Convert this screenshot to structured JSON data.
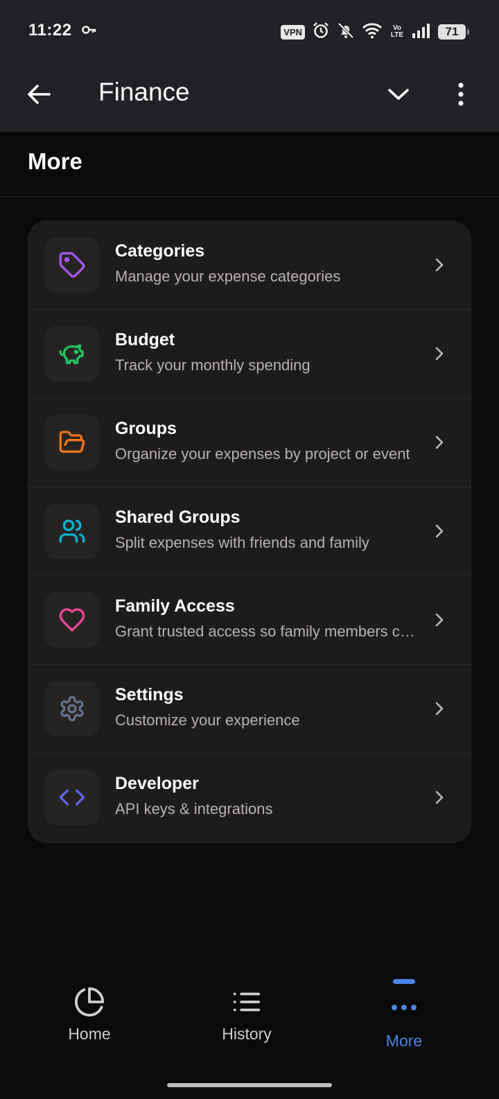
{
  "status_bar": {
    "time": "11:22",
    "vpn_label": "VPN",
    "volte_label": "Vo LTE",
    "battery_level": "71",
    "icons": [
      "key-icon",
      "alarm-icon",
      "bell-off-icon",
      "wifi-icon",
      "signal-icon",
      "battery-icon"
    ]
  },
  "app_bar": {
    "title": "Finance"
  },
  "section": {
    "title": "More"
  },
  "menu": {
    "items": [
      {
        "title": "Categories",
        "subtitle": "Manage your expense categories",
        "icon": "tag-icon",
        "color": "#a855f7"
      },
      {
        "title": "Budget",
        "subtitle": "Track your monthly spending",
        "icon": "piggy-bank-icon",
        "color": "#22c55e"
      },
      {
        "title": "Groups",
        "subtitle": "Organize your expenses by project or event",
        "icon": "folder-open-icon",
        "color": "#f97316"
      },
      {
        "title": "Shared Groups",
        "subtitle": "Split expenses with friends and family",
        "icon": "users-icon",
        "color": "#06b6d4"
      },
      {
        "title": "Family Access",
        "subtitle": "Grant trusted access so family members can help",
        "icon": "heart-icon",
        "color": "#ec4899"
      },
      {
        "title": "Settings",
        "subtitle": "Customize your experience",
        "icon": "gear-icon",
        "color": "#64748b"
      },
      {
        "title": "Developer",
        "subtitle": "API keys & integrations",
        "icon": "code-icon",
        "color": "#6366f1"
      }
    ]
  },
  "bottom_nav": {
    "items": [
      {
        "label": "Home",
        "icon": "pie-chart-icon",
        "active": false
      },
      {
        "label": "History",
        "icon": "list-icon",
        "active": false
      },
      {
        "label": "More",
        "icon": "more-horizontal-icon",
        "active": true
      }
    ],
    "active_color": "#4a86e8"
  }
}
